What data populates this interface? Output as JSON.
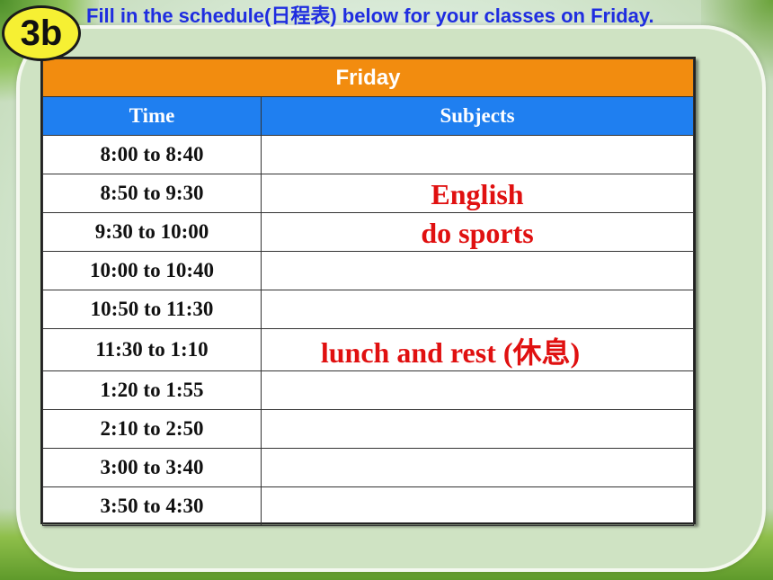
{
  "badge": "3b",
  "instruction": "Fill in the schedule(日程表) below for your classes on Friday.",
  "schedule": {
    "day": "Friday",
    "headers": {
      "time": "Time",
      "subjects": "Subjects"
    },
    "rows": [
      {
        "time": "8:00 to 8:40",
        "subject": ""
      },
      {
        "time": "8:50 to 9:30",
        "subject": "English"
      },
      {
        "time": "9:30 to 10:00",
        "subject": "do sports"
      },
      {
        "time": "10:00 to 10:40",
        "subject": ""
      },
      {
        "time": "10:50 to 11:30",
        "subject": ""
      },
      {
        "time": "11:30 to 1:10",
        "subject": "lunch and rest (休息)"
      },
      {
        "time": "1:20 to 1:55",
        "subject": ""
      },
      {
        "time": "2:10 to 2:50",
        "subject": ""
      },
      {
        "time": "3:00 to 3:40",
        "subject": ""
      },
      {
        "time": "3:50 to 4:30",
        "subject": ""
      }
    ]
  },
  "colors": {
    "day_header": "#f28c0f",
    "column_header": "#1f7ff0",
    "filled_text": "#e01010",
    "instruction_text": "#1f2de0",
    "badge": "#f6f033"
  }
}
